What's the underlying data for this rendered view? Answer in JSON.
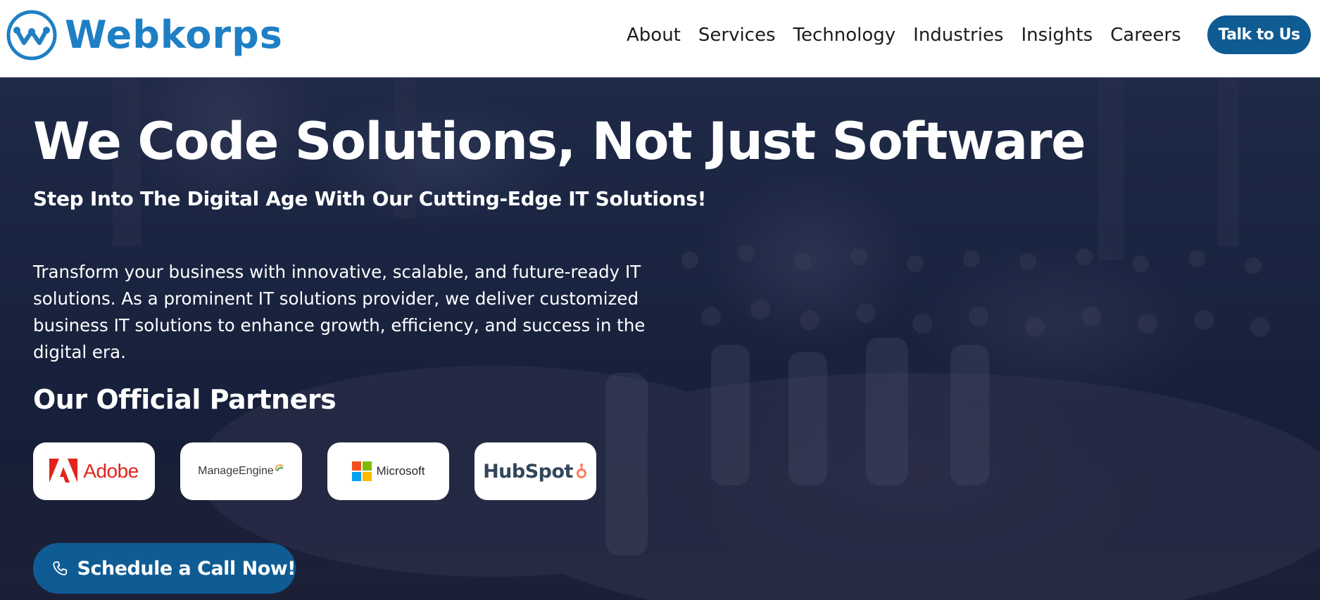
{
  "brand": {
    "name": "Webkorps",
    "logo_icon": "webkorps-logo-icon",
    "color": "#1f7fc4"
  },
  "nav": {
    "items": [
      "About",
      "Services",
      "Technology",
      "Industries",
      "Insights",
      "Careers"
    ],
    "cta_label": "Talk to Us"
  },
  "hero": {
    "headline": "We Code Solutions, Not Just Software",
    "subheadline": "Step Into The Digital Age With Our Cutting-Edge IT Solutions!",
    "description": "Transform your business with innovative, scalable, and future-ready IT solutions. As a prominent IT solutions provider, we deliver customized business IT solutions to enhance growth, efficiency, and success in the digital era.",
    "partners_title": "Our Official Partners",
    "partners": [
      {
        "name": "Adobe",
        "icon": "adobe-logo-icon"
      },
      {
        "name": "ManageEngine",
        "icon": "manageengine-logo-icon"
      },
      {
        "name": "Microsoft",
        "icon": "microsoft-logo-icon"
      },
      {
        "name": "HubSpot",
        "icon": "hubspot-logo-icon"
      }
    ],
    "cta_label": "Schedule a Call Now!",
    "cta_icon": "phone-icon"
  },
  "colors": {
    "accent": "#0f5b94",
    "hero_overlay": "#1c2545",
    "adobe_red": "#e2231a",
    "hubspot_orange": "#ff7a59"
  }
}
